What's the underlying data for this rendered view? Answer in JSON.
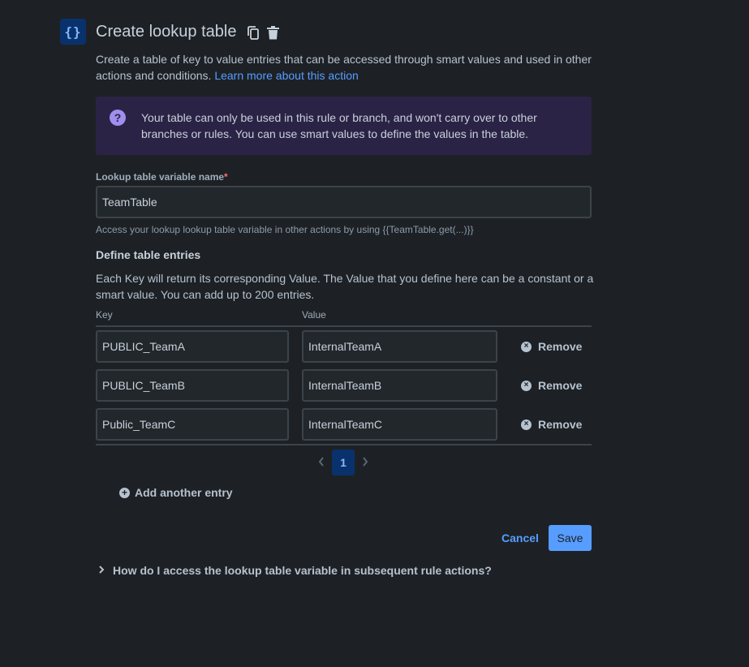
{
  "header": {
    "icon": "curly-braces-icon",
    "icon_glyph": "{}",
    "title": "Create lookup table",
    "copy_icon": "copy-icon",
    "delete_icon": "trash-icon"
  },
  "description": {
    "text": "Create a table of key to value entries that can be accessed through smart values and used in other actions and conditions.",
    "link": "Learn more about this action"
  },
  "info_panel": {
    "icon": "question-circle-icon",
    "text": "Your table can only be used in this rule or branch, and won't carry over to other branches or rules. You can use smart values to define the values in the table."
  },
  "variable_name": {
    "label": "Lookup table variable name",
    "required_marker": "*",
    "value": "TeamTable",
    "helper": "Access your lookup lookup table variable in other actions by using {{TeamTable.get(...)}}"
  },
  "entries": {
    "title": "Define table entries",
    "description": "Each Key will return its corresponding Value. The Value that you define here can be a constant or a smart value. You can add up to 200 entries.",
    "key_header": "Key",
    "value_header": "Value",
    "remove_label": "Remove",
    "rows": [
      {
        "key": "PUBLIC_TeamA",
        "value": "InternalTeamA"
      },
      {
        "key": "PUBLIC_TeamB",
        "value": "InternalTeamB"
      },
      {
        "key": "Public_TeamC",
        "value": "InternalTeamC"
      }
    ]
  },
  "pagination": {
    "current_page": "1"
  },
  "add_entry_label": "Add another entry",
  "actions": {
    "cancel": "Cancel",
    "save": "Save"
  },
  "faq": {
    "question": "How do I access the lookup table variable in subsequent rule actions?"
  },
  "colors": {
    "background": "#1d2125",
    "accent": "#579dff",
    "info_panel_bg": "#2b2345",
    "info_icon": "#9f8fef",
    "required": "#f87168"
  }
}
